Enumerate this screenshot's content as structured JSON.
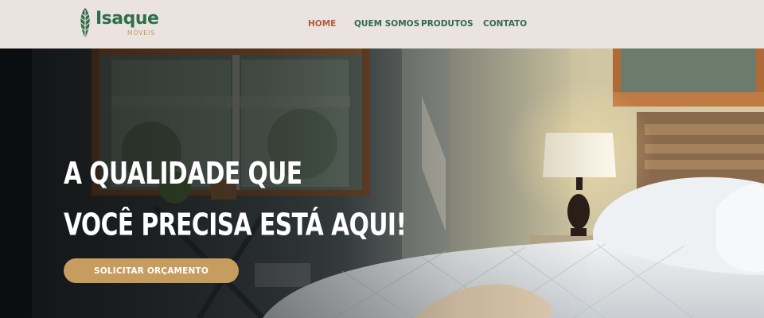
{
  "brand": {
    "name": "Isaque",
    "tagline": "MÓVEIS"
  },
  "nav": {
    "items": [
      {
        "label": "HOME",
        "active": true
      },
      {
        "label": "QUEM SOMOS",
        "active": false
      },
      {
        "label": "PRODUTOS",
        "active": false
      },
      {
        "label": "CONTATO",
        "active": false
      }
    ]
  },
  "hero": {
    "headline_line1": "A QUALIDADE QUE",
    "headline_line2": "VOCÊ PRECISA ESTÁ AQUI!",
    "cta_label": "SOLICITAR ORÇAMENTO",
    "image": "bedroom-photo"
  },
  "colors": {
    "header_bg": "#ebe3df",
    "brand_green": "#2f6e4a",
    "brand_gold": "#c2964f",
    "nav_active": "#b35a3a",
    "cta_bg": "#c69c5f"
  }
}
